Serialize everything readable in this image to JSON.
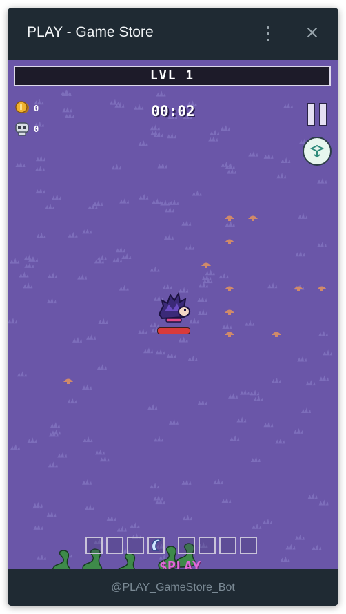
{
  "window": {
    "title": "PLAY - Game Store",
    "footer_text": "@PLAY_GameStore_Bot"
  },
  "game": {
    "level_label": "LVL 1",
    "timer": "00:02",
    "coins": "0",
    "kills": "0",
    "brand": "$PLAY",
    "colors": {
      "background": "#6a56a8",
      "grass": "#8476c2",
      "mushroom": "#d08a6a",
      "hp": "#d83a3a",
      "brand": "#e06ad8"
    },
    "icons": [
      "coin-icon",
      "skull-icon",
      "pause-icon",
      "ability-icon",
      "player-hedgehog",
      "snake-enemy",
      "menu-dots-icon",
      "close-icon"
    ],
    "inventory_slot_count": 8,
    "player_hp_fraction": 1.0
  }
}
